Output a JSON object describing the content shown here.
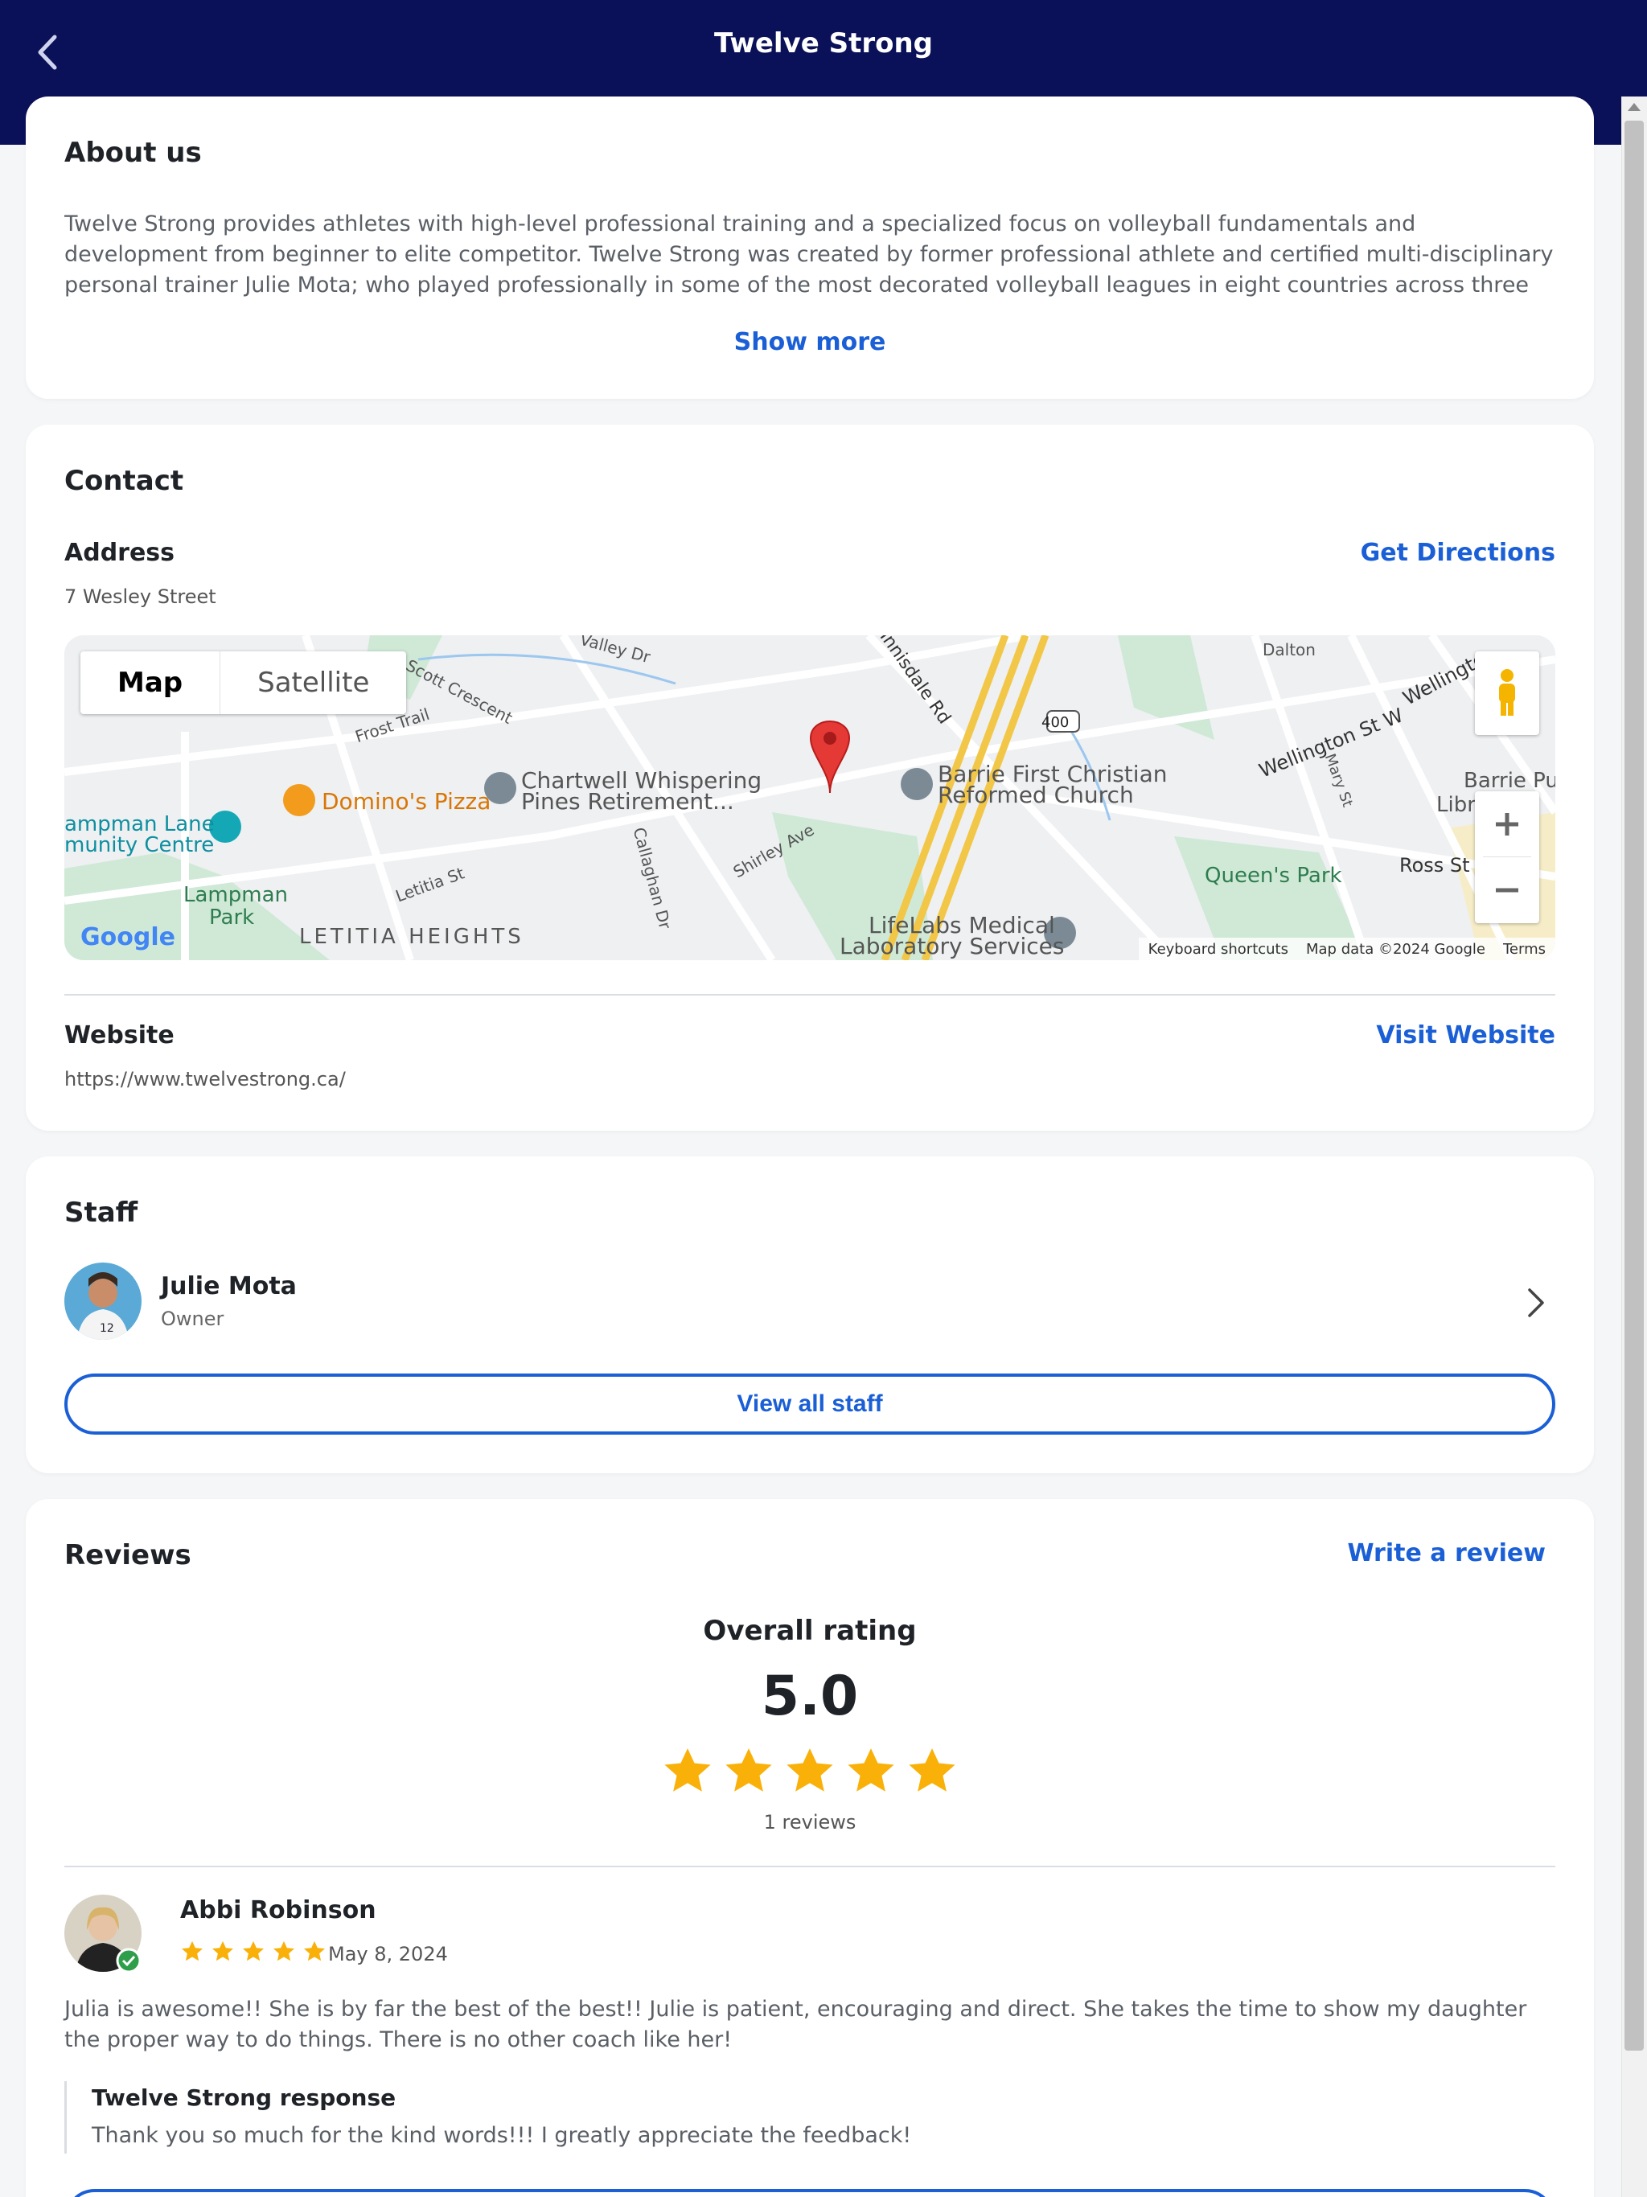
{
  "header": {
    "title": "Twelve Strong"
  },
  "about": {
    "title": "About us",
    "text": "Twelve Strong provides athletes with high-level professional training and a specialized focus on volleyball fundamentals and development from beginner to elite competitor.   Twelve Strong was created by former professional athlete and certified multi-disciplinary personal trainer Julie Mota; who played professionally in some of the most decorated volleyball leagues in eight countries across three different continents.     Twelve Strong’s...",
    "show_more": "Show more"
  },
  "contact": {
    "title": "Contact",
    "address_label": "Address",
    "address": "7 Wesley Street",
    "directions": "Get Directions",
    "website_label": "Website",
    "website": "https://www.twelvestrong.ca/",
    "visit": "Visit Website",
    "map": {
      "toggle_map": "Map",
      "toggle_satellite": "Satellite",
      "labels": {
        "valley": "Valley Dr",
        "scott": "Scott Crescent",
        "frost": "Frost Trail",
        "innisdale": "Innisdale Rd",
        "dalton": "Dalton",
        "wellington": "Wellington St W",
        "wellington2": "Wellingto",
        "chartwell": "Chartwell Whispering",
        "chartwell2": "Pines Retirement...",
        "barriefirst": "Barrie First Christian",
        "barriefirst2": "Reformed Church",
        "dominos": "Domino's Pizza",
        "lampmanlane": "ampman Lane",
        "community": "munity Centre",
        "lampmanpark": "Lampman",
        "lampmanpark2": "Park",
        "letitia": "Letitia St",
        "letitiaheights": "LETITIA HEIGHTS",
        "callaghan": "Callaghan Dr",
        "shirley": "Shirley Ave",
        "lifelabs": "LifeLabs Medical",
        "lifelabs2": "Laboratory Services",
        "queens": "Queen's Park",
        "ross": "Ross St",
        "barriepub": "Barrie Pu",
        "library": "Library -",
        "mary": "Mary St",
        "highway": "400",
        "google": "Google"
      },
      "attribution": {
        "shortcuts": "Keyboard shortcuts",
        "data": "Map data ©2024 Google",
        "terms": "Terms"
      }
    }
  },
  "staff": {
    "title": "Staff",
    "member": {
      "name": "Julie Mota",
      "role": "Owner"
    },
    "view_all": "View all staff"
  },
  "reviews": {
    "title": "Reviews",
    "write": "Write a review",
    "overall_label": "Overall rating",
    "overall_value": "5.0",
    "rating_stars": 5,
    "count": "1 reviews",
    "review": {
      "author": "Abbi Robinson",
      "stars": 5,
      "date": "May 8, 2024",
      "text": "Julia is awesome!! She is by far the best of the best!! Julie is patient, encouraging and direct. She takes the time to show my daughter the proper way to do things. There is no other coach like her!",
      "response_title": "Twelve Strong response",
      "response_text": "Thank you so much for the kind words!!! I greatly appreciate the feedback!"
    }
  },
  "colors": {
    "header": "#0b1158",
    "accent": "#1a5fd6",
    "star": "#f9b10a",
    "pin": "#e53935"
  }
}
